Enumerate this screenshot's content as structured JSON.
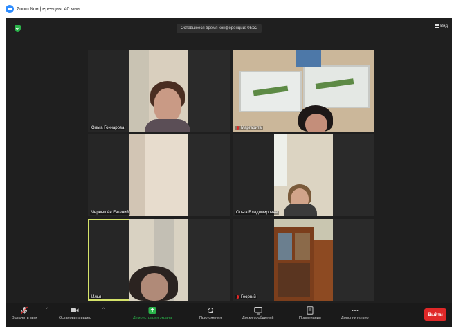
{
  "window": {
    "title": "Zoom Конференция, 40 мин"
  },
  "meeting": {
    "timer_text": "Оставшееся время конференции: 05:32",
    "view_label": "Вид"
  },
  "participants": [
    {
      "name": "Ольга Гончарова",
      "muted": false
    },
    {
      "name": "Маргарита",
      "muted": true
    },
    {
      "name": "Чернышёв Евгений",
      "muted": false
    },
    {
      "name": "Ольга Владимировна",
      "muted": false
    },
    {
      "name": "Илья",
      "muted": false,
      "active_speaker": true
    },
    {
      "name": "Георгий",
      "muted": true
    }
  ],
  "toolbar": {
    "unmute_label": "Включить звук",
    "stop_video_label": "Остановить видео",
    "share_screen_label": "Демонстрация экрана",
    "apps_label": "Приложения",
    "whiteboards_label": "Доски сообщений",
    "notes_label": "Примечания",
    "more_label": "Дополнительно",
    "leave_label": "Выйти"
  },
  "colors": {
    "accent_green": "#2ab34a",
    "leave_red": "#e02828",
    "active_speaker_border": "#d5e36a",
    "background": "#1f1f1f"
  }
}
